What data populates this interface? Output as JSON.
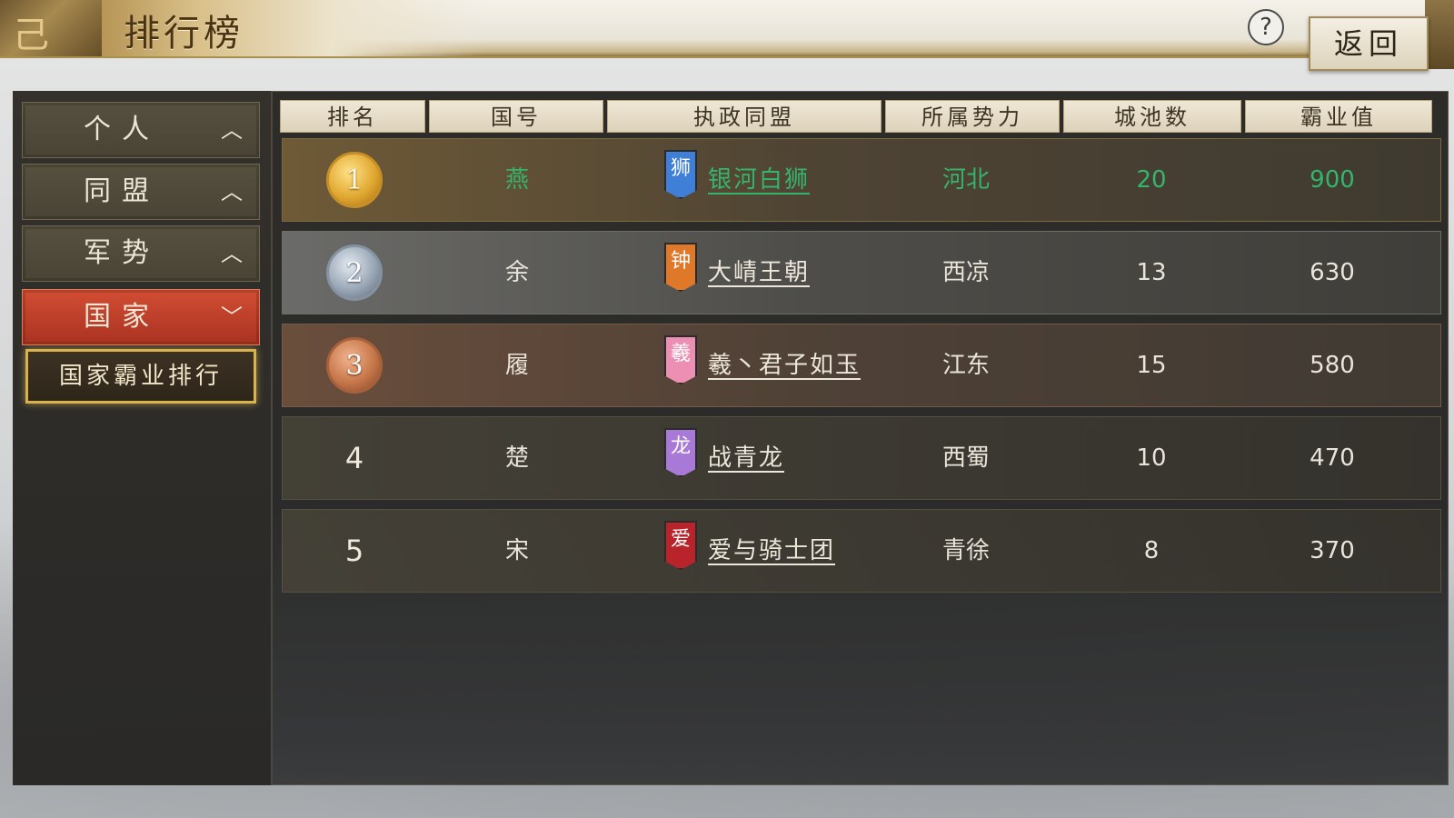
{
  "header": {
    "title": "排行榜",
    "help_label": "?",
    "back_label": "返回"
  },
  "sidebar": {
    "tabs": [
      {
        "label": "个人",
        "chevron": "chevron-up-icon",
        "active": false
      },
      {
        "label": "同盟",
        "chevron": "chevron-up-icon",
        "active": false
      },
      {
        "label": "军势",
        "chevron": "chevron-up-icon",
        "active": false
      },
      {
        "label": "国家",
        "chevron": "chevron-down-icon",
        "active": true
      }
    ],
    "sub_item": "国家霸业排行"
  },
  "table": {
    "columns": [
      "排名",
      "国号",
      "执政同盟",
      "所属势力",
      "城池数",
      "霸业值"
    ],
    "rows": [
      {
        "rank": "1",
        "medal": "gold",
        "country": "燕",
        "banner_char": "狮",
        "banner_color": "#3f7fd8",
        "alliance": "银河白狮",
        "faction": "河北",
        "cities": "20",
        "score": "900",
        "highlight": true
      },
      {
        "rank": "2",
        "medal": "silver",
        "country": "余",
        "banner_char": "钟",
        "banner_color": "#e0782a",
        "alliance": "大崝王朝",
        "faction": "西凉",
        "cities": "13",
        "score": "630",
        "highlight": false
      },
      {
        "rank": "3",
        "medal": "bronze",
        "country": "履",
        "banner_char": "羲",
        "banner_color": "#ec8fb2",
        "alliance": "羲丶君子如玉",
        "faction": "江东",
        "cities": "15",
        "score": "580",
        "highlight": false
      },
      {
        "rank": "4",
        "medal": "",
        "country": "楚",
        "banner_char": "龙",
        "banner_color": "#a979d8",
        "alliance": "战青龙",
        "faction": "西蜀",
        "cities": "10",
        "score": "470",
        "highlight": false
      },
      {
        "rank": "5",
        "medal": "",
        "country": "宋",
        "banner_char": "爱",
        "banner_color": "#b9242a",
        "alliance": "爱与骑士团",
        "faction": "青徐",
        "cities": "8",
        "score": "370",
        "highlight": false
      }
    ]
  },
  "colors": {
    "highlight_text": "#35b46b",
    "active_tab": "#c23f2a",
    "sub_item_border": "#d8b24a"
  }
}
